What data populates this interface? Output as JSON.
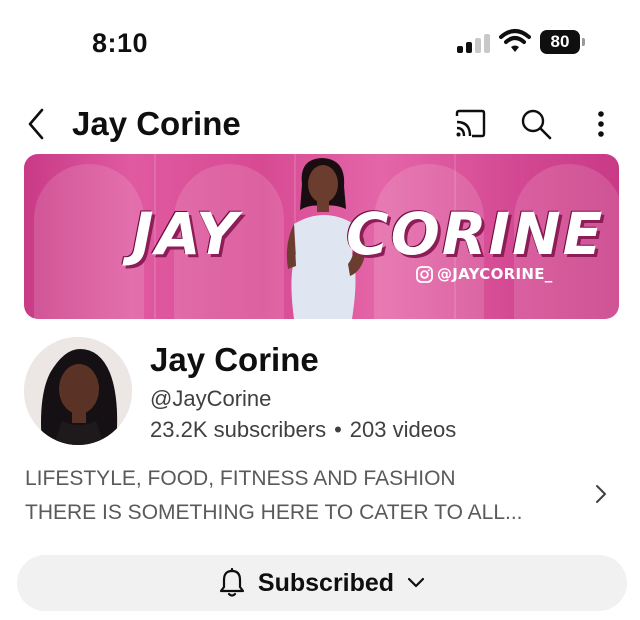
{
  "status_bar": {
    "time": "8:10",
    "battery": "80"
  },
  "header": {
    "title": "Jay Corine",
    "icons": [
      "back-icon",
      "cast-icon",
      "search-icon",
      "more-vert-icon"
    ]
  },
  "banner": {
    "first_word": "JAY",
    "last_word": "CORINE",
    "handle": "@JAYCORINE_",
    "colors": {
      "primary": "#d74a93",
      "dark": "#8d1d56"
    }
  },
  "channel": {
    "name": "Jay Corine",
    "handle": "@JayCorine",
    "subscribers": "23.2K subscribers",
    "separator": "•",
    "videos": "203 videos"
  },
  "description": {
    "line1": "LIFESTYLE, FOOD, FITNESS AND FASHION",
    "line2": "THERE IS SOMETHING HERE TO CATER TO ALL..."
  },
  "subscribe": {
    "label": "Subscribed",
    "icon": "bell-icon"
  }
}
